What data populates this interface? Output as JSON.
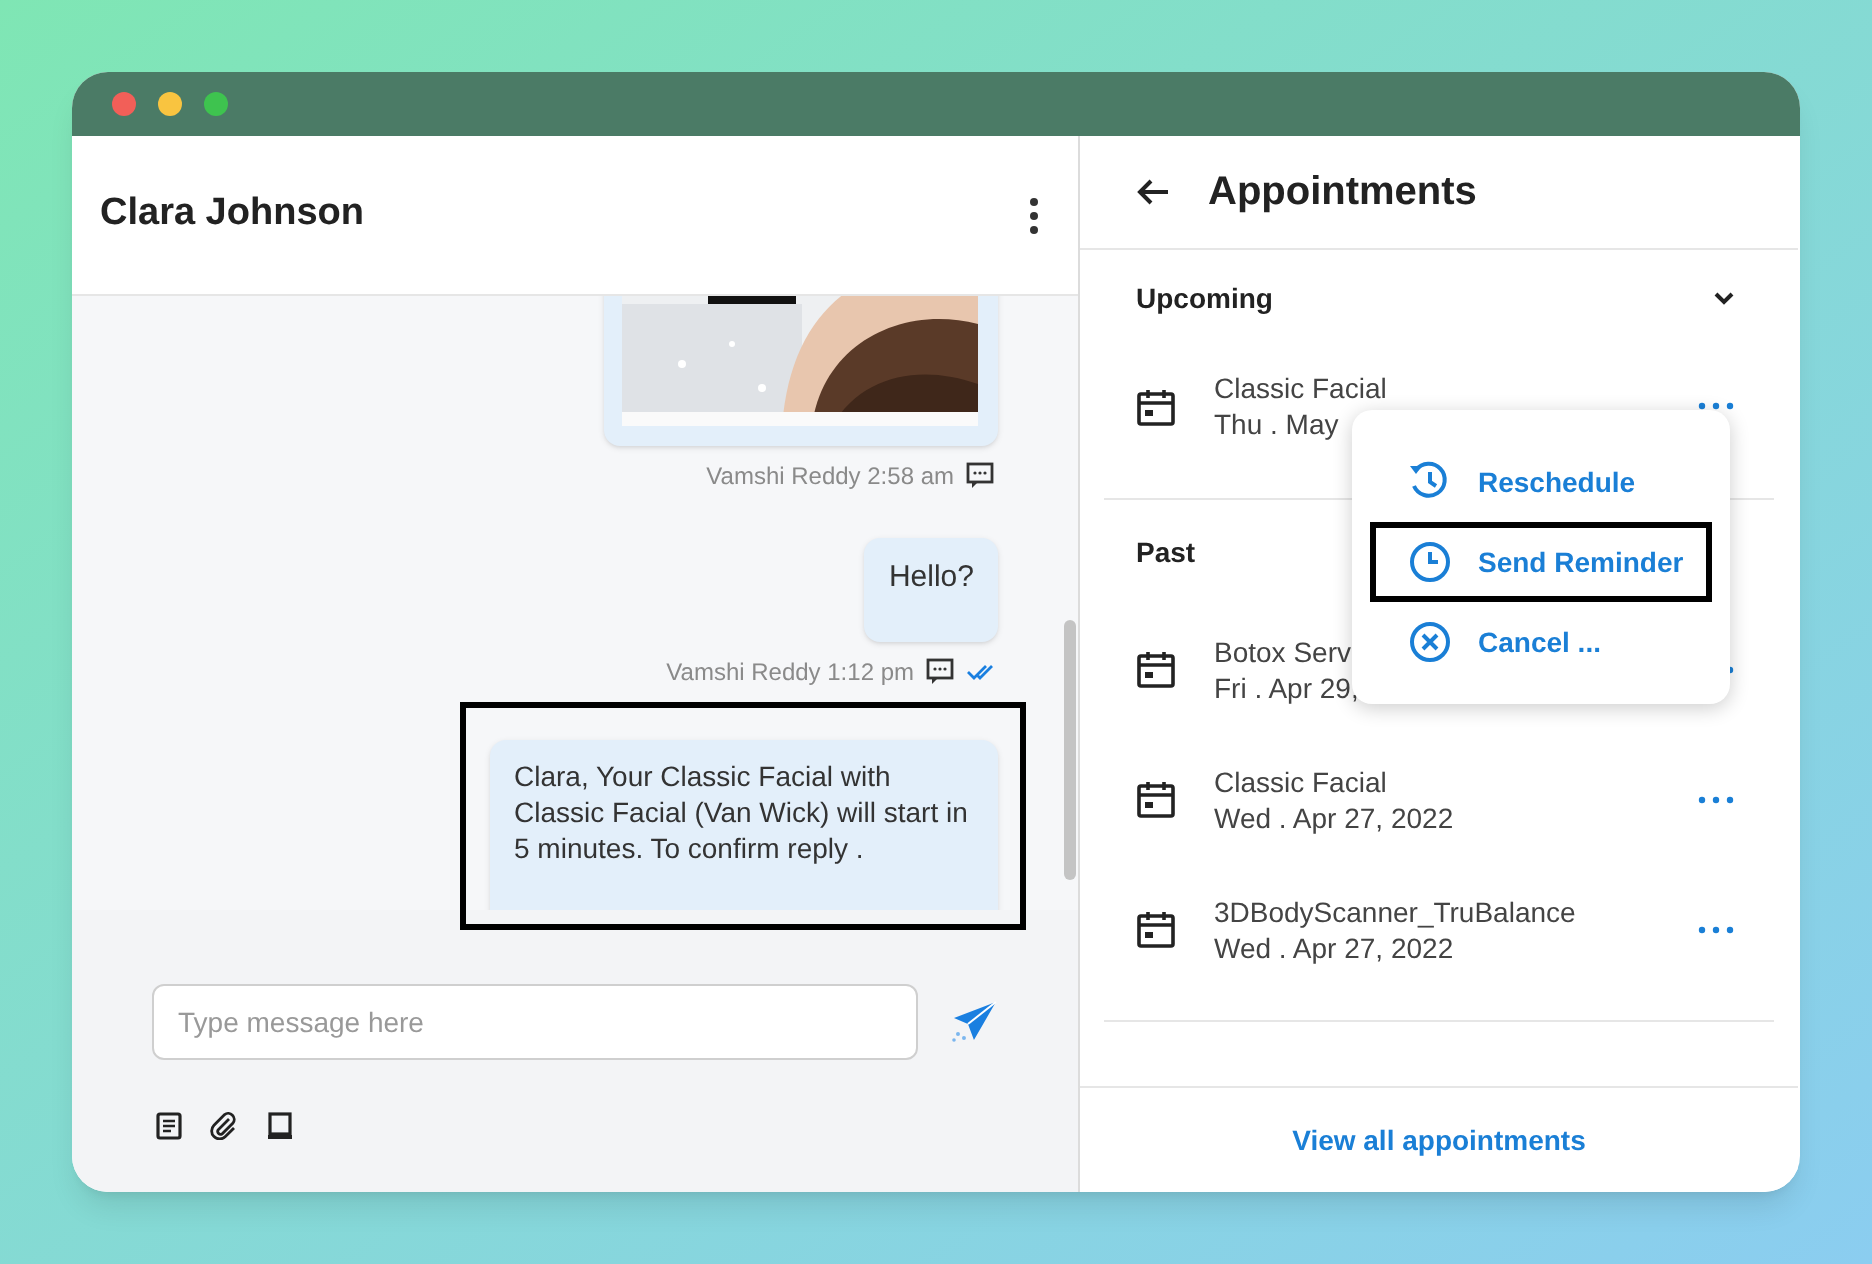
{
  "conversation": {
    "contact_name": "Clara Johnson",
    "messages": [
      {
        "kind": "picture",
        "meta": "Vamshi Reddy 2:58 am",
        "read": false,
        "highlighted": false
      },
      {
        "kind": "text",
        "text": "Hello?",
        "meta": "Vamshi Reddy 1:12 pm",
        "read": true,
        "highlighted": false
      },
      {
        "kind": "text",
        "text": "Clara, Your Classic Facial with Classic Facial (Van Wick) will start in 5 minutes. To confirm reply .",
        "highlighted": true
      }
    ]
  },
  "composer": {
    "placeholder": "Type message here"
  },
  "appointments": {
    "title": "Appointments",
    "upcoming": {
      "title": "Upcoming",
      "expanded": true,
      "items": [
        {
          "name": "Classic Facial",
          "date": "Thu . May"
        }
      ]
    },
    "past": {
      "title": "Past",
      "items": [
        {
          "name": "Botox Serv",
          "date": "Fri . Apr 29,"
        },
        {
          "name": "Classic Facial",
          "date": "Wed . Apr 27, 2022"
        },
        {
          "name": "3DBodyScanner_TruBalance",
          "date": "Wed . Apr 27, 2022"
        }
      ]
    },
    "action_menu": {
      "items": [
        {
          "kind": "reschedule",
          "label": "Reschedule",
          "highlighted": false
        },
        {
          "kind": "reminder",
          "label": "Send Reminder",
          "highlighted": true
        },
        {
          "kind": "cancel",
          "label": "Cancel ..."
        }
      ]
    },
    "footer_link": "View all appointments"
  }
}
